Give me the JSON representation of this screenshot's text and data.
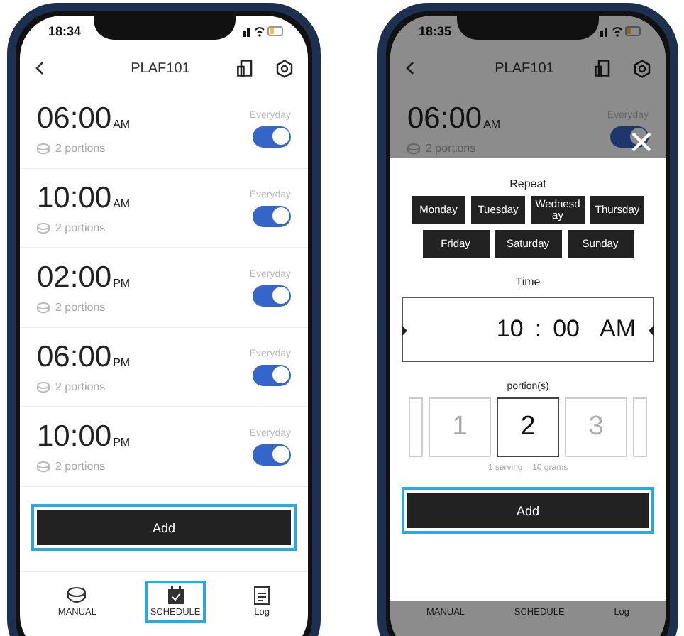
{
  "left_phone": {
    "status_time": "18:34",
    "title": "PLAF101",
    "schedules": [
      {
        "time": "06:00",
        "period": "AM",
        "portions": "2 portions",
        "repeat": "Everyday",
        "on": true
      },
      {
        "time": "10:00",
        "period": "AM",
        "portions": "2 portions",
        "repeat": "Everyday",
        "on": true
      },
      {
        "time": "02:00",
        "period": "PM",
        "portions": "2 portions",
        "repeat": "Everyday",
        "on": true
      },
      {
        "time": "06:00",
        "period": "PM",
        "portions": "2 portions",
        "repeat": "Everyday",
        "on": true
      },
      {
        "time": "10:00",
        "period": "PM",
        "portions": "2 portions",
        "repeat": "Everyday",
        "on": true
      }
    ],
    "add_button": {
      "label": "Add",
      "highlighted": true
    },
    "nav": [
      {
        "kind": "manual",
        "label": "MANUAL",
        "highlighted": false
      },
      {
        "kind": "schedule",
        "label": "SCHEDULE",
        "highlighted": true
      },
      {
        "kind": "log",
        "label": "Log",
        "highlighted": false
      }
    ]
  },
  "right_phone": {
    "status_time": "18:35",
    "title": "PLAF101",
    "schedules": [
      {
        "time": "06:00",
        "period": "AM",
        "portions": "2 portions",
        "repeat": "Everyday",
        "on": true
      }
    ],
    "nav": [
      {
        "label": "MANUAL"
      },
      {
        "label": "SCHEDULE"
      },
      {
        "label": "Log"
      }
    ],
    "dialog": {
      "repeat_label": "Repeat",
      "days": [
        {
          "label": "Monday"
        },
        {
          "label": "Tuesday"
        },
        {
          "label": "Wednesday"
        },
        {
          "label": "Thursday"
        },
        {
          "label": "Friday"
        },
        {
          "label": "Saturday"
        },
        {
          "label": "Sunday"
        }
      ],
      "time_label": "Time",
      "hour": "10",
      "separator": ":",
      "minute": "00",
      "period": "AM",
      "portion_label": "portion(s)",
      "portions": [
        {
          "label": "1",
          "selected": false
        },
        {
          "label": "2",
          "selected": true
        },
        {
          "label": "3",
          "selected": false
        }
      ],
      "note": "1 serving = 10 grams",
      "add_button": {
        "label": "Add",
        "highlighted": true
      }
    }
  }
}
